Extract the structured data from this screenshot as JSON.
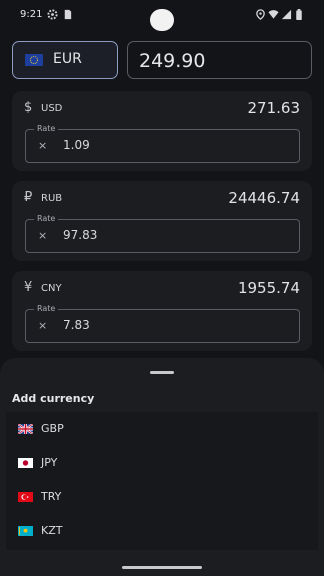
{
  "status_bar": {
    "time": "9:21"
  },
  "base": {
    "code": "EUR",
    "amount": "249.90"
  },
  "conversions": [
    {
      "symbol": "$",
      "code": "USD",
      "amount": "271.63",
      "rate_label": "Rate",
      "operator": "×",
      "rate": "1.09"
    },
    {
      "symbol": "₽",
      "code": "RUB",
      "amount": "24446.74",
      "rate_label": "Rate",
      "operator": "×",
      "rate": "97.83"
    },
    {
      "symbol": "¥",
      "code": "CNY",
      "amount": "1955.74",
      "rate_label": "Rate",
      "operator": "×",
      "rate": "7.83"
    }
  ],
  "sheet": {
    "title": "Add currency",
    "items": [
      {
        "code": "GBP",
        "flag": "uk-flag-icon"
      },
      {
        "code": "JPY",
        "flag": "japan-flag-icon"
      },
      {
        "code": "TRY",
        "flag": "turkey-flag-icon"
      },
      {
        "code": "KZT",
        "flag": "kazakhstan-flag-icon"
      }
    ]
  },
  "colors": {
    "background": "#131418",
    "card": "#1c1d21",
    "accent_border": "#8e9cc2"
  }
}
